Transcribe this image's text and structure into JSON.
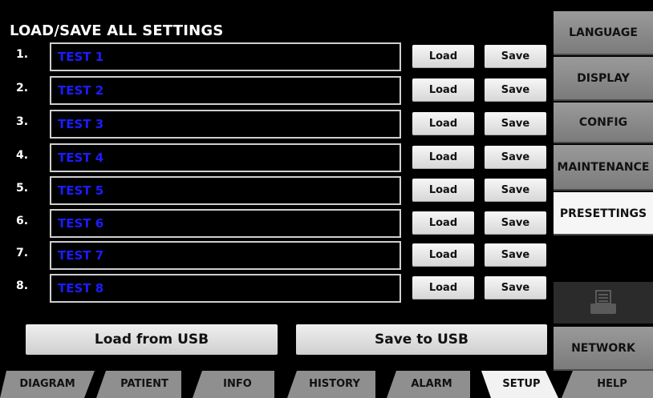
{
  "title": "LOAD/SAVE ALL SETTINGS",
  "presets": [
    {
      "num": "1.",
      "name": "TEST 1",
      "load": "Load",
      "save": "Save"
    },
    {
      "num": "2.",
      "name": "TEST 2",
      "load": "Load",
      "save": "Save"
    },
    {
      "num": "3.",
      "name": "TEST 3",
      "load": "Load",
      "save": "Save"
    },
    {
      "num": "4.",
      "name": "TEST 4",
      "load": "Load",
      "save": "Save"
    },
    {
      "num": "5.",
      "name": "TEST 5",
      "load": "Load",
      "save": "Save"
    },
    {
      "num": "6.",
      "name": "TEST 6",
      "load": "Load",
      "save": "Save"
    },
    {
      "num": "7.",
      "name": "TEST 7",
      "load": "Load",
      "save": "Save"
    },
    {
      "num": "8.",
      "name": "TEST 8",
      "load": "Load",
      "save": "Save"
    }
  ],
  "usb": {
    "load": "Load from USB",
    "save": "Save to USB"
  },
  "side_menu": {
    "language": "LANGUAGE",
    "display": "DISPLAY",
    "config": "CONFIG",
    "maintenance": "MAINTENANCE",
    "presettings": "PRESETTINGS",
    "network": "NETWORK",
    "active": "PRESETTINGS",
    "print_icon": "printer-icon"
  },
  "tabs": {
    "diagram": "DIAGRAM",
    "patient": "PATIENT",
    "info": "INFO",
    "history": "HISTORY",
    "alarm": "ALARM",
    "setup": "SETUP",
    "help": "HELP",
    "active": "SETUP"
  },
  "colors": {
    "preset_text": "#1c1cff",
    "background": "#000000",
    "active_tab": "#f2f2f2"
  }
}
